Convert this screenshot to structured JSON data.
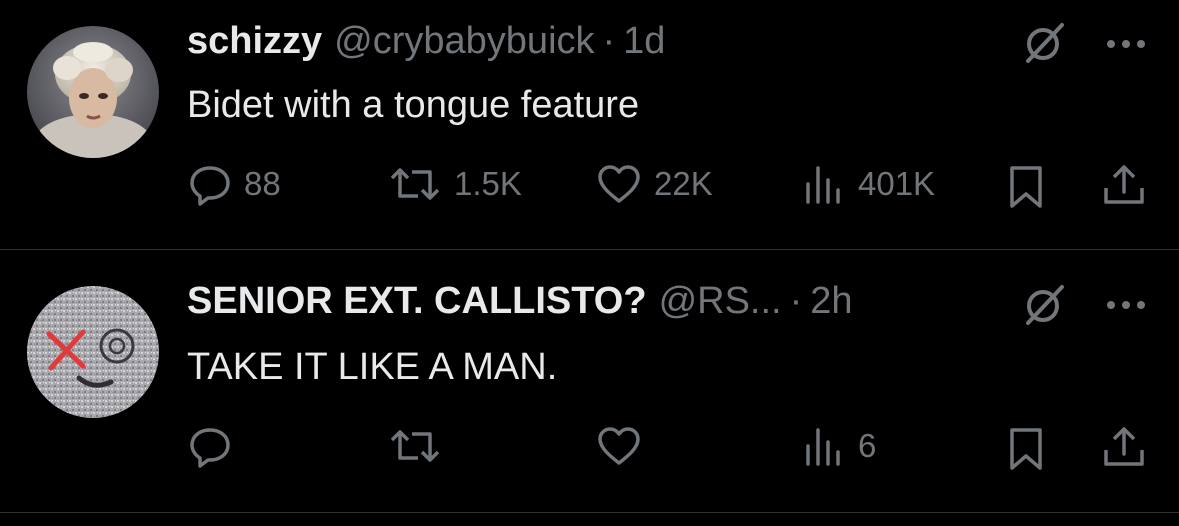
{
  "tweets": [
    {
      "display_name": "schizzy",
      "handle": "@crybabybuick",
      "separator": "·",
      "time": "1d",
      "text": "Bidet with a tongue feature",
      "replies": "88",
      "reposts": "1.5K",
      "likes": "22K",
      "views": "401K"
    },
    {
      "display_name": "SENIOR EXT. CALLISTO?",
      "handle": "@RS...",
      "separator": "·",
      "time": "2h",
      "text": "TAKE IT LIKE A MAN.",
      "replies": "",
      "reposts": "",
      "likes": "",
      "views": "6"
    }
  ],
  "icons": [
    "reply-icon",
    "repost-icon",
    "like-icon",
    "views-icon",
    "bookmark-icon",
    "share-icon",
    "grok-icon",
    "more-icon"
  ],
  "colors": {
    "background": "#000000",
    "text": "#e7e9ea",
    "muted": "#71767b",
    "divider": "#2f3336"
  }
}
